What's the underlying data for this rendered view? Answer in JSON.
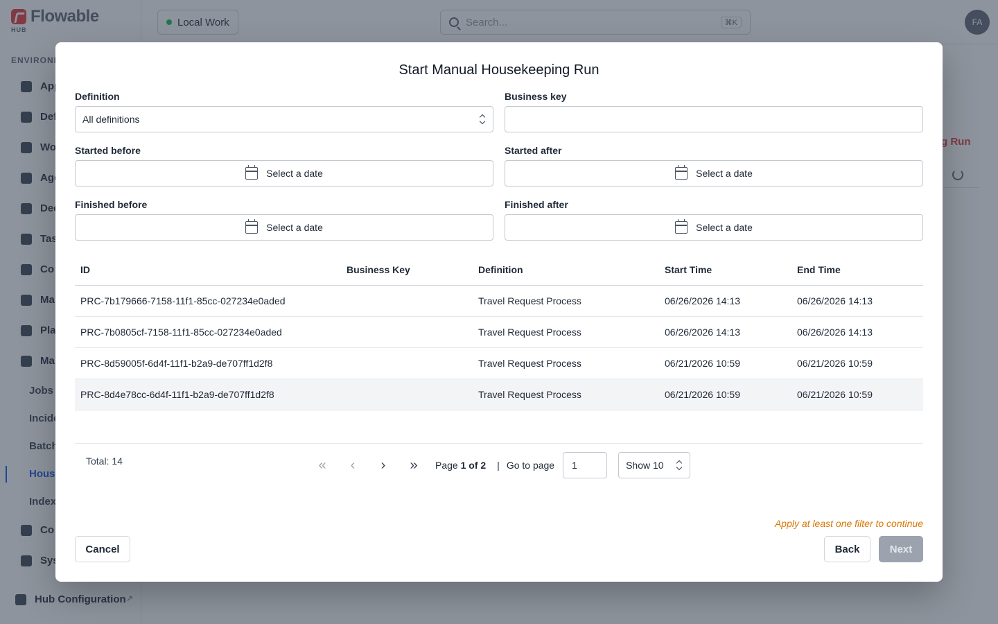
{
  "app": {
    "logo_text": "Flowable",
    "logo_sub": "HUB",
    "env_section_label": "ENVIRONM",
    "nav_items": [
      {
        "label": "App",
        "icon": "apps-icon"
      },
      {
        "label": "Def",
        "icon": "definitions-icon"
      },
      {
        "label": "Wo",
        "icon": "inbox-icon"
      },
      {
        "label": "Age",
        "icon": "agents-icon"
      },
      {
        "label": "Dec",
        "icon": "table-icon"
      },
      {
        "label": "Tas",
        "icon": "tasks-icon"
      },
      {
        "label": "Co",
        "icon": "content-icon"
      },
      {
        "label": "Ma",
        "icon": "document-icon"
      },
      {
        "label": "Pla",
        "icon": "platform-icon"
      },
      {
        "label": "Ma",
        "icon": "tools-icon"
      }
    ],
    "sub_items": [
      "Jobs",
      "Incide",
      "Batch",
      "House",
      "Indexe"
    ],
    "nav_items_bottom": [
      {
        "label": "Co",
        "icon": "key-icon"
      },
      {
        "label": "Sys",
        "icon": "gauge-icon"
      }
    ],
    "hub_config": "Hub Configuration",
    "env_chip": "Local Work",
    "search_placeholder": "Search...",
    "search_shortcut": "⌘K",
    "avatar_initials": "FA",
    "bg_run_link": "g Run"
  },
  "modal": {
    "title": "Start Manual Housekeeping Run",
    "definition": {
      "label": "Definition",
      "value": "All definitions"
    },
    "business_key": {
      "label": "Business key",
      "value": ""
    },
    "started_before": {
      "label": "Started before",
      "placeholder": "Select a date"
    },
    "started_after": {
      "label": "Started after",
      "placeholder": "Select a date"
    },
    "finished_before": {
      "label": "Finished before",
      "placeholder": "Select a date"
    },
    "finished_after": {
      "label": "Finished after",
      "placeholder": "Select a date"
    },
    "table": {
      "columns": [
        "ID",
        "Business Key",
        "Definition",
        "Start Time",
        "End Time"
      ],
      "rows": [
        {
          "id": "PRC-7b179666-7158-11f1-85cc-027234e0aded",
          "business_key": "",
          "definition": "Travel Request Process",
          "start": "06/26/2026 14:13",
          "end": "06/26/2026 14:13"
        },
        {
          "id": "PRC-7b0805cf-7158-11f1-85cc-027234e0aded",
          "business_key": "",
          "definition": "Travel Request Process",
          "start": "06/26/2026 14:13",
          "end": "06/26/2026 14:13"
        },
        {
          "id": "PRC-8d59005f-6d4f-11f1-b2a9-de707ff1d2f8",
          "business_key": "",
          "definition": "Travel Request Process",
          "start": "06/21/2026 10:59",
          "end": "06/21/2026 10:59"
        },
        {
          "id": "PRC-8d4e78cc-6d4f-11f1-b2a9-de707ff1d2f8",
          "business_key": "",
          "definition": "Travel Request Process",
          "start": "06/21/2026 10:59",
          "end": "06/21/2026 10:59"
        }
      ]
    },
    "pagination": {
      "total": "Total: 14",
      "page_prefix": "Page ",
      "page_current": "1 of 2",
      "separator": "|",
      "goto_label": "Go to page",
      "goto_value": "1",
      "show": "Show 10"
    },
    "hint": "Apply at least one filter to continue",
    "cancel": "Cancel",
    "back": "Back",
    "next": "Next"
  }
}
